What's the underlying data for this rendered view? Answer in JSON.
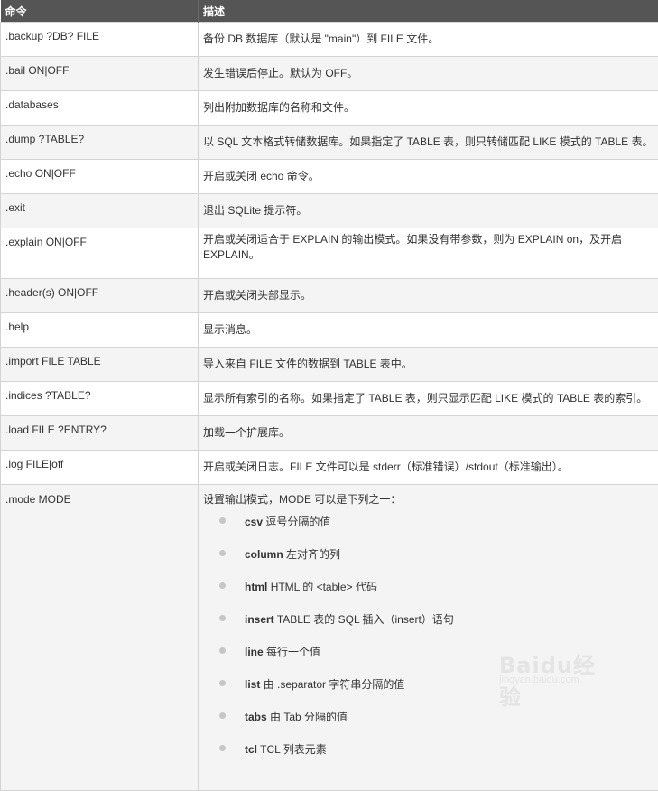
{
  "header": {
    "col_command": "命令",
    "col_description": "描述"
  },
  "rows": [
    {
      "cmd": ".backup ?DB? FILE",
      "desc": "备份 DB 数据库（默认是 \"main\"）到 FILE 文件。"
    },
    {
      "cmd": ".bail ON|OFF",
      "desc": "发生错误后停止。默认为 OFF。"
    },
    {
      "cmd": ".databases",
      "desc": "列出附加数据库的名称和文件。"
    },
    {
      "cmd": ".dump ?TABLE?",
      "desc": "以 SQL 文本格式转储数据库。如果指定了 TABLE 表，则只转储匹配 LIKE 模式的 TABLE 表。"
    },
    {
      "cmd": ".echo ON|OFF",
      "desc": "开启或关闭 echo 命令。"
    },
    {
      "cmd": ".exit",
      "desc": "退出 SQLite 提示符。"
    },
    {
      "cmd": ".explain ON|OFF",
      "desc": "开启或关闭适合于 EXPLAIN 的输出模式。如果没有带参数，则为 EXPLAIN on，及开启 EXPLAIN。"
    },
    {
      "cmd": ".header(s) ON|OFF",
      "desc": "开启或关闭头部显示。"
    },
    {
      "cmd": ".help",
      "desc": "显示消息。"
    },
    {
      "cmd": ".import FILE TABLE",
      "desc": "导入来自 FILE 文件的数据到 TABLE 表中。"
    },
    {
      "cmd": ".indices ?TABLE?",
      "desc": "显示所有索引的名称。如果指定了 TABLE 表，则只显示匹配 LIKE 模式的 TABLE 表的索引。"
    },
    {
      "cmd": ".load FILE ?ENTRY?",
      "desc": "加载一个扩展库。"
    },
    {
      "cmd": ".log FILE|off",
      "desc": "开启或关闭日志。FILE 文件可以是 stderr（标准错误）/stdout（标准输出）。"
    }
  ],
  "mode": {
    "cmd": ".mode MODE",
    "intro": "设置输出模式，MODE 可以是下列之一：",
    "items": [
      {
        "name": "csv",
        "desc": "逗号分隔的值"
      },
      {
        "name": "column",
        "desc": "左对齐的列"
      },
      {
        "name": "html",
        "desc": "HTML 的 <table> 代码"
      },
      {
        "name": "insert",
        "desc": "TABLE 表的 SQL 插入（insert）语句"
      },
      {
        "name": "line",
        "desc": "每行一个值"
      },
      {
        "name": "list",
        "desc": "由 .separator 字符串分隔的值"
      },
      {
        "name": "tabs",
        "desc": "由 Tab 分隔的值"
      },
      {
        "name": "tcl",
        "desc": "TCL 列表元素"
      }
    ]
  },
  "watermark": {
    "text": "Baidu经验",
    "sub": "jingyan.baidu.com"
  }
}
